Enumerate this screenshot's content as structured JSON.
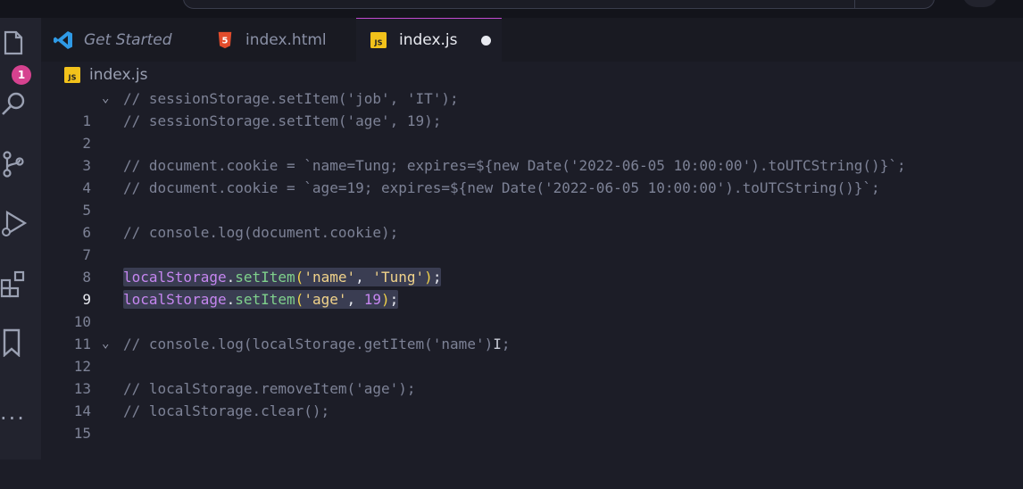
{
  "colors": {
    "accent": "#c24bd0",
    "badge": "#d6428f",
    "background": "#1c1d27"
  },
  "activity_bar": {
    "icons": [
      "explorer-icon",
      "search-icon",
      "source-control-icon",
      "run-debug-icon",
      "extensions-icon",
      "bookmark-icon"
    ],
    "explorer_badge": "1",
    "more": "···"
  },
  "tabs": [
    {
      "label": "Get Started",
      "icon": "vscode-logo-icon"
    },
    {
      "label": "index.html",
      "icon": "html5-icon",
      "icon_text": "5"
    },
    {
      "label": "index.js",
      "icon": "js-icon",
      "icon_text": "JS",
      "active": true,
      "dirty": true
    }
  ],
  "breadcrumb": {
    "file": "index.js",
    "icon_text": "JS"
  },
  "editor": {
    "line_numbers": [
      "1",
      "2",
      "3",
      "4",
      "5",
      "6",
      "7",
      "8",
      "9",
      "10",
      "11",
      "12",
      "13",
      "14",
      "15"
    ],
    "comments": {
      "l1": "// sessionStorage.setItem('job', 'IT');",
      "l2": "// sessionStorage.setItem('age', 19);",
      "l4": "// document.cookie = `name=Tung; expires=${new Date('2022-06-05 10:00:00').toUTCString()}`;",
      "l5": "// document.cookie = `age=19; expires=${new Date('2022-06-05 10:00:00').toUTCString()}`;",
      "l7": "// console.log(document.cookie);",
      "l12_a": "// console.log(localStorage.getItem('name')",
      "l12_b": ";",
      "l14": "// localStorage.removeItem('age');",
      "l15": "// localStorage.clear();"
    },
    "l9": {
      "obj": "localStorage",
      "dot": ".",
      "fn": "setItem",
      "open": "(",
      "arg1": "'name'",
      "comma": ", ",
      "arg2": "'Tung'",
      "close": ")",
      "semi": ";"
    },
    "l10": {
      "obj": "localStorage",
      "dot": ".",
      "fn": "setItem",
      "open": "(",
      "arg1": "'age'",
      "comma": ", ",
      "arg2": "19",
      "close": ")",
      "semi": ";"
    },
    "cursor_glyph": "I"
  }
}
